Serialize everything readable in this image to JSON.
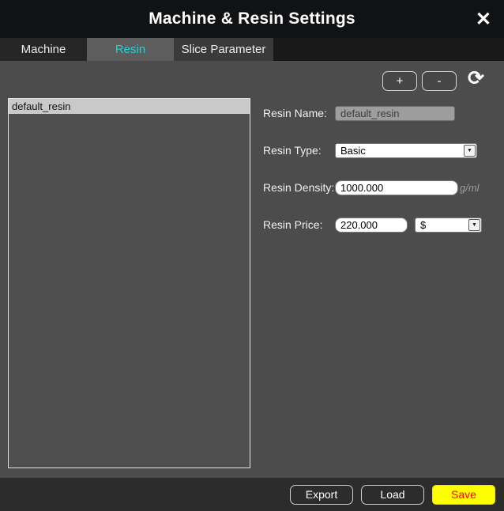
{
  "titlebar": {
    "title": "Machine & Resin Settings",
    "close_icon": "✕"
  },
  "tabs": [
    {
      "label": "Machine",
      "active": false
    },
    {
      "label": "Resin",
      "active": true
    },
    {
      "label": "Slice Parameter",
      "active": false
    }
  ],
  "list": {
    "items": [
      {
        "label": "default_resin",
        "selected": true
      }
    ]
  },
  "toolbar": {
    "add_label": "+",
    "remove_label": "-",
    "refresh_icon": "⟳"
  },
  "form": {
    "name": {
      "label": "Resin Name:",
      "value": "default_resin"
    },
    "type": {
      "label": "Resin Type:",
      "value": "Basic",
      "arrow_icon": "▼"
    },
    "density": {
      "label": "Resin Density:",
      "value": "1000.000",
      "unit": "g/ml"
    },
    "price": {
      "label": "Resin Price:",
      "value": "220.000",
      "currency": "$",
      "arrow_icon": "▼"
    }
  },
  "footer": {
    "export_label": "Export",
    "load_label": "Load",
    "save_label": "Save"
  },
  "colors": {
    "accent": "#1ed3d3",
    "save_bg": "#ffff00",
    "save_text": "#ff0000"
  }
}
